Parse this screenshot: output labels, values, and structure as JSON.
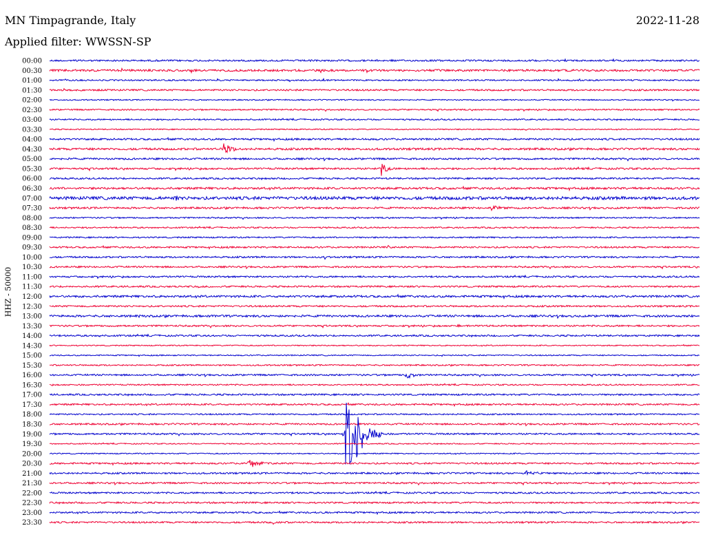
{
  "header": {
    "station": "MN Timpagrande, Italy",
    "date": "2022-11-28",
    "filter_label": "Applied filter: WWSSN-SP"
  },
  "chart_data": {
    "type": "line",
    "title": "MN Timpagrande, Italy",
    "subtitle": "Applied filter: WWSSN-SP",
    "ylabel": "HHZ - 50000",
    "colors": [
      "#0000cc",
      "#ee0033"
    ],
    "row_labels": [
      "00:00",
      "00:30",
      "01:00",
      "01:30",
      "02:00",
      "02:30",
      "03:00",
      "03:30",
      "04:00",
      "04:30",
      "05:00",
      "05:30",
      "06:00",
      "06:30",
      "07:00",
      "07:30",
      "08:00",
      "08:30",
      "09:00",
      "09:30",
      "10:00",
      "10:30",
      "11:00",
      "11:30",
      "12:00",
      "12:30",
      "13:00",
      "13:30",
      "14:00",
      "14:30",
      "15:00",
      "15:30",
      "16:00",
      "16:30",
      "17:00",
      "17:30",
      "18:00",
      "18:30",
      "19:00",
      "19:30",
      "20:00",
      "20:30",
      "21:00",
      "21:30",
      "22:00",
      "22:30",
      "23:00",
      "23:30"
    ],
    "noise": [
      1.2,
      1.5,
      1.0,
      1.2,
      0.8,
      1.0,
      1.0,
      0.8,
      1.3,
      1.5,
      1.3,
      1.3,
      1.2,
      1.5,
      2.2,
      1.3,
      1.0,
      1.0,
      1.0,
      1.2,
      1.2,
      1.2,
      1.2,
      1.2,
      1.5,
      1.2,
      1.5,
      1.2,
      1.2,
      0.8,
      0.8,
      1.0,
      1.2,
      1.0,
      1.2,
      1.2,
      1.0,
      1.2,
      1.2,
      0.8,
      0.8,
      1.2,
      1.2,
      1.2,
      1.2,
      1.2,
      1.2,
      1.2
    ],
    "events": [
      {
        "row": 0,
        "minute": 1.1,
        "amplitude": 2,
        "duration_min": 0.3
      },
      {
        "row": 1,
        "minute": 22.8,
        "amplitude": 2,
        "duration_min": 0.4
      },
      {
        "row": 2,
        "minute": 4.8,
        "amplitude": 3,
        "duration_min": 0.3
      },
      {
        "row": 3,
        "minute": 10.9,
        "amplitude": 2,
        "duration_min": 0.3
      },
      {
        "row": 5,
        "minute": 28.3,
        "amplitude": 3,
        "duration_min": 0.3
      },
      {
        "row": 7,
        "minute": 21.9,
        "amplitude": 2,
        "duration_min": 0.8
      },
      {
        "row": 9,
        "minute": 8.0,
        "amplitude": 16,
        "duration_min": 0.9
      },
      {
        "row": 11,
        "minute": 15.3,
        "amplitude": 22,
        "duration_min": 0.6
      },
      {
        "row": 13,
        "minute": 1.3,
        "amplitude": 2,
        "duration_min": 0.4
      },
      {
        "row": 13,
        "minute": 13.5,
        "amplitude": 2,
        "duration_min": 0.3
      },
      {
        "row": 14,
        "minute": 5.8,
        "amplitude": 9,
        "duration_min": 0.4
      },
      {
        "row": 15,
        "minute": 20.3,
        "amplitude": 4,
        "duration_min": 1.8
      },
      {
        "row": 17,
        "minute": 1.8,
        "amplitude": 2,
        "duration_min": 0.3
      },
      {
        "row": 19,
        "minute": 15.6,
        "amplitude": 3,
        "duration_min": 0.4
      },
      {
        "row": 20,
        "minute": 12.7,
        "amplitude": 4,
        "duration_min": 0.2
      },
      {
        "row": 20,
        "minute": 29.0,
        "amplitude": 2,
        "duration_min": 0.8
      },
      {
        "row": 23,
        "minute": 6.9,
        "amplitude": 2,
        "duration_min": 0.6
      },
      {
        "row": 23,
        "minute": 23.8,
        "amplitude": 3,
        "duration_min": 0.2
      },
      {
        "row": 26,
        "minute": 4.1,
        "amplitude": 3,
        "duration_min": 0.2
      },
      {
        "row": 26,
        "minute": 7.3,
        "amplitude": 2,
        "duration_min": 0.5
      },
      {
        "row": 27,
        "minute": 18.8,
        "amplitude": 3,
        "duration_min": 0.5
      },
      {
        "row": 27,
        "minute": 20.1,
        "amplitude": 2,
        "duration_min": 0.5
      },
      {
        "row": 27,
        "minute": 26.7,
        "amplitude": 2,
        "duration_min": 0.3
      },
      {
        "row": 28,
        "minute": 2.3,
        "amplitude": 2,
        "duration_min": 0.2
      },
      {
        "row": 29,
        "minute": 16.3,
        "amplitude": 2,
        "duration_min": 0.3
      },
      {
        "row": 30,
        "minute": 18.1,
        "amplitude": 2,
        "duration_min": 0.2
      },
      {
        "row": 32,
        "minute": 16.4,
        "amplitude": 6,
        "duration_min": 1.3
      },
      {
        "row": 38,
        "minute": 13.6,
        "amplitude": 80,
        "duration_min": 1.8
      },
      {
        "row": 41,
        "minute": 9.1,
        "amplitude": 8,
        "duration_min": 1.5
      },
      {
        "row": 42,
        "minute": 21.9,
        "amplitude": 5,
        "duration_min": 1.6
      },
      {
        "row": 43,
        "minute": 19.9,
        "amplitude": 3,
        "duration_min": 0.3
      },
      {
        "row": 46,
        "minute": 12.7,
        "amplitude": 2,
        "duration_min": 0.3
      },
      {
        "row": 47,
        "minute": 10.3,
        "amplitude": 3,
        "duration_min": 0.5
      }
    ],
    "x_minutes": [
      0,
      30
    ],
    "grid": false
  }
}
